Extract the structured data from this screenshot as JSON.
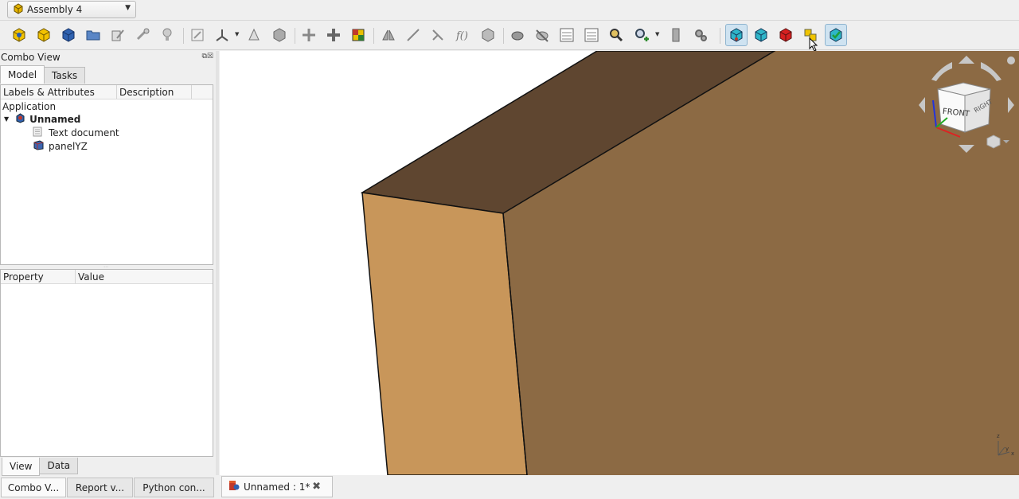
{
  "workbench": {
    "label": "Assembly 4"
  },
  "combo_view": {
    "title": "Combo View",
    "tabs": [
      {
        "label": "Model"
      },
      {
        "label": "Tasks"
      }
    ],
    "tree": {
      "columns": [
        "Labels & Attributes",
        "Description"
      ],
      "root_label": "Application",
      "items": [
        {
          "label": "Unnamed"
        },
        {
          "label": "Text document"
        },
        {
          "label": "panelYZ"
        }
      ]
    },
    "property_columns": [
      "Property",
      "Value"
    ],
    "bottom_tabs": [
      {
        "label": "View"
      },
      {
        "label": "Data"
      }
    ]
  },
  "dock_tabs": [
    {
      "label": "Combo V..."
    },
    {
      "label": "Report v..."
    },
    {
      "label": "Python con..."
    }
  ],
  "document_tab": {
    "label": "Unnamed : 1*"
  },
  "navcube": {
    "face_label": "FRONT",
    "side_label": "RIGHT"
  },
  "colors": {
    "panel_top": "#5f4630",
    "panel_front": "#c8965a",
    "panel_side": "#8c6a44",
    "navcube_arrow": "#c7c7c7",
    "active_button": "#cfe3f1"
  }
}
